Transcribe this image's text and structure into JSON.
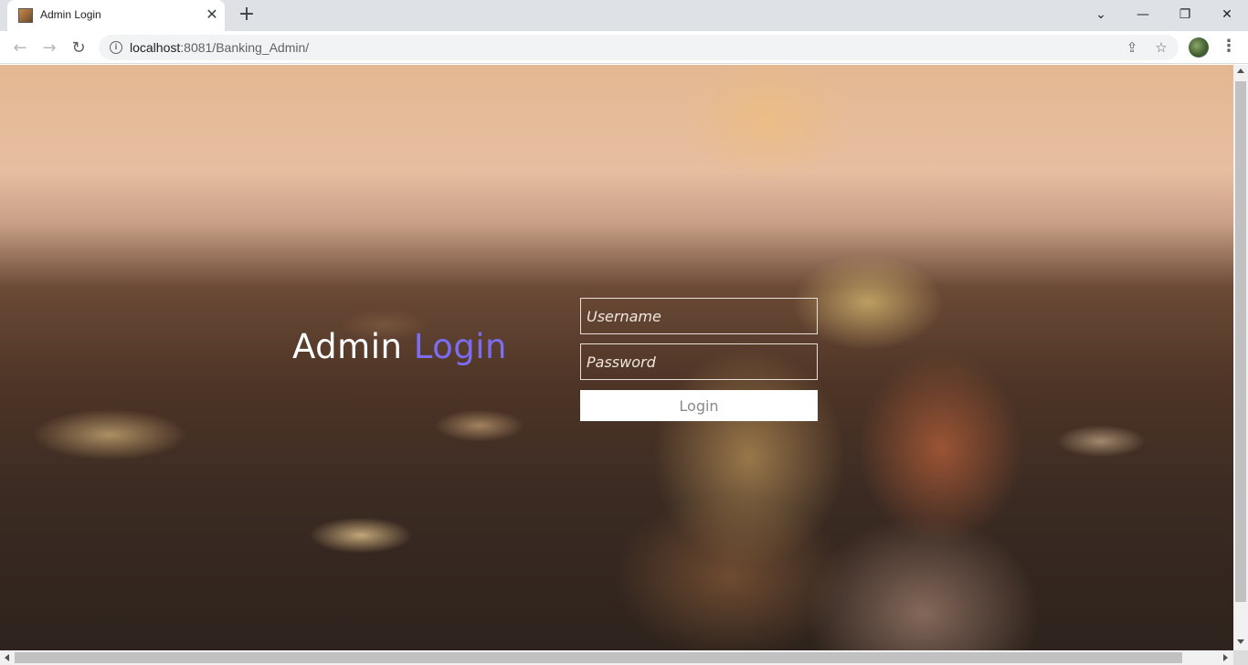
{
  "browser": {
    "tab": {
      "title": "Admin Login",
      "close_glyph": "✕"
    },
    "new_tab_glyph": "+",
    "window_controls": {
      "dropdown": "⌄",
      "minimize": "—",
      "restore": "❐",
      "close": "✕"
    },
    "nav": {
      "back": "←",
      "forward": "→",
      "reload": "↻"
    },
    "url": {
      "host": "localhost",
      "rest": ":8081/Banking_Admin/"
    },
    "icons": {
      "info": "i",
      "share": "⇪",
      "bookmark": "☆",
      "menu": "⋮"
    }
  },
  "page": {
    "heading": {
      "part1": "Admin ",
      "part2": "Login"
    },
    "username": {
      "placeholder": "Username",
      "value": ""
    },
    "password": {
      "placeholder": "Password",
      "value": ""
    },
    "login_button": "Login"
  },
  "colors": {
    "accent": "#7b6cf0",
    "heading": "#ffffff",
    "button_text": "#8a8a8a"
  }
}
